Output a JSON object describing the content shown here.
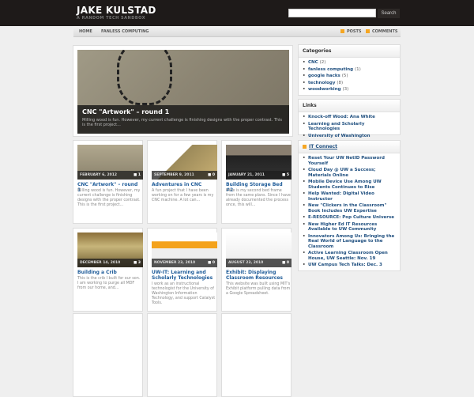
{
  "header": {
    "title": "JAKE KULSTAD",
    "tagline": "A RANDOM TECH SANDBOX",
    "search_placeholder": "",
    "search_button": "Search"
  },
  "nav": {
    "items": [
      "HOME",
      "FANLESS COMPUTING"
    ],
    "posts": "POSTS",
    "comments": "COMMENTS"
  },
  "featured": {
    "title": "CNC \"Artwork\" – round 1",
    "excerpt": "Milling wood is fun. However, my current challenge is finishing designs with the proper contrast. This is the first project..."
  },
  "posts": [
    {
      "date": "FEBRUARY 6, 2012",
      "comments": "1",
      "title": "CNC \"Artwork\" – round 1",
      "excerpt": "Milling wood is fun. However, my current challenge is finishing designs with the proper contrast. This is the first project..."
    },
    {
      "date": "SEPTEMBER 9, 2011",
      "comments": "0",
      "title": "Adventures in CNC",
      "excerpt": "A fun project that I have been working on for a few years is my CNC machine. A lot can..."
    },
    {
      "date": "JANUARY 21, 2011",
      "comments": "5",
      "title": "Building Storage Bed #2",
      "excerpt": "Here is my second bed frame from the same plans. Since I have already documented the process once, this will..."
    },
    {
      "date": "DECEMBER 14, 2010",
      "comments": "3",
      "title": "Building a Crib",
      "excerpt": "This is the crib I built for our son. I am working to purge all MDF from our home, and..."
    },
    {
      "date": "NOVEMBER 23, 2010",
      "comments": "0",
      "title": "UW-IT: Learning and Scholarly Technologies",
      "excerpt": "I work as an instructional technologist for the University of Washington Information Technology, and support Catalyst Tools."
    },
    {
      "date": "AUGUST 23, 2010",
      "comments": "0",
      "title": "Exhibit: Displaying Classroom Resources",
      "excerpt": "This website was built using MIT's Exhibit platform pulling data from a Google Spreadsheet."
    }
  ],
  "sidebar": {
    "categories": {
      "title": "Categories",
      "items": [
        {
          "label": "CNC",
          "count": "(2)"
        },
        {
          "label": "fanless computing",
          "count": "(1)"
        },
        {
          "label": "google hacks",
          "count": "(5)"
        },
        {
          "label": "technology",
          "count": "(8)"
        },
        {
          "label": "woodworking",
          "count": "(3)"
        }
      ]
    },
    "links": {
      "title": "Links",
      "items": [
        "Knock-off Wood: Ana White",
        "Learning and Scholarly Technologies",
        "University of Washington"
      ]
    },
    "feed": {
      "title": "IT Connect",
      "items": [
        "Reset Your UW NetID Password Yourself",
        "Cloud Day @ UW a Success; Materials Online",
        "Mobile Device Use Among UW Students Continues to Rise",
        "Help Wanted: Digital Video Instructor",
        "New \"Clickers in the Classroom\" Book Includes UW Expertise",
        "E-RESOURCE: Pop Culture Universe",
        "New Higher Ed IT Resources Available to UW Community",
        "Innovators Among Us: Bringing the Real World of Language to the Classroom",
        "Active Learning Classroom Open House, UW Seattle: Nov. 19",
        "UW Campus Tech Talks: Dec. 3"
      ]
    }
  }
}
